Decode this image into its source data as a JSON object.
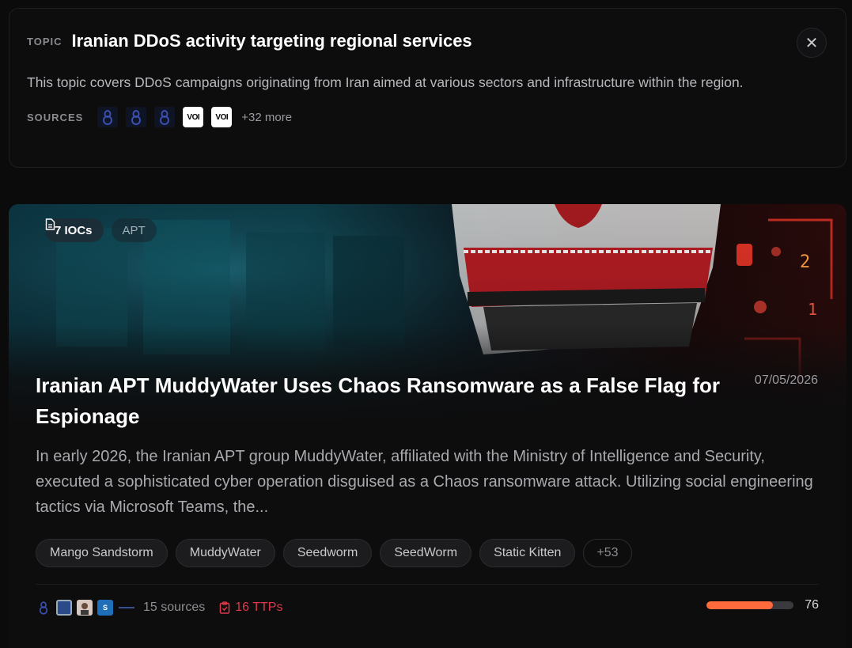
{
  "topic": {
    "label": "TOPIC",
    "title": "Iranian DDoS activity targeting regional services",
    "description": "This topic covers DDoS campaigns originating from Iran aimed at various sectors and infrastructure within the region.",
    "sources_label": "SOURCES",
    "source_icons": [
      "source-icon-blue",
      "source-icon-blue",
      "source-icon-blue",
      "source-icon-voi",
      "source-icon-voi"
    ],
    "voi_text": "VOI",
    "more_sources": "+32 more",
    "close_icon": "close-icon"
  },
  "article": {
    "ioc_label": "7 IOCs",
    "category": "APT",
    "title": "Iranian APT MuddyWater Uses Chaos Ransomware as a False Flag for Espionage",
    "date": "07/05/2026",
    "summary": "In early 2026, the Iranian APT group MuddyWater, affiliated with the Ministry of Intelligence and Security, executed a sophisticated cyber operation disguised as a Chaos ransomware attack. Utilizing social engineering tactics via Microsoft Teams, the...",
    "tags": [
      "Mango Sandstorm",
      "MuddyWater",
      "Seedworm",
      "SeedWorm",
      "Static Kitten"
    ],
    "more_tags": "+53",
    "sources_count": "15 sources",
    "ttps": "16 TTPs",
    "score": 76,
    "score_fraction": 0.76,
    "accent_colors": {
      "score": "#ff6a3d",
      "ttps": "#e0374a"
    }
  }
}
